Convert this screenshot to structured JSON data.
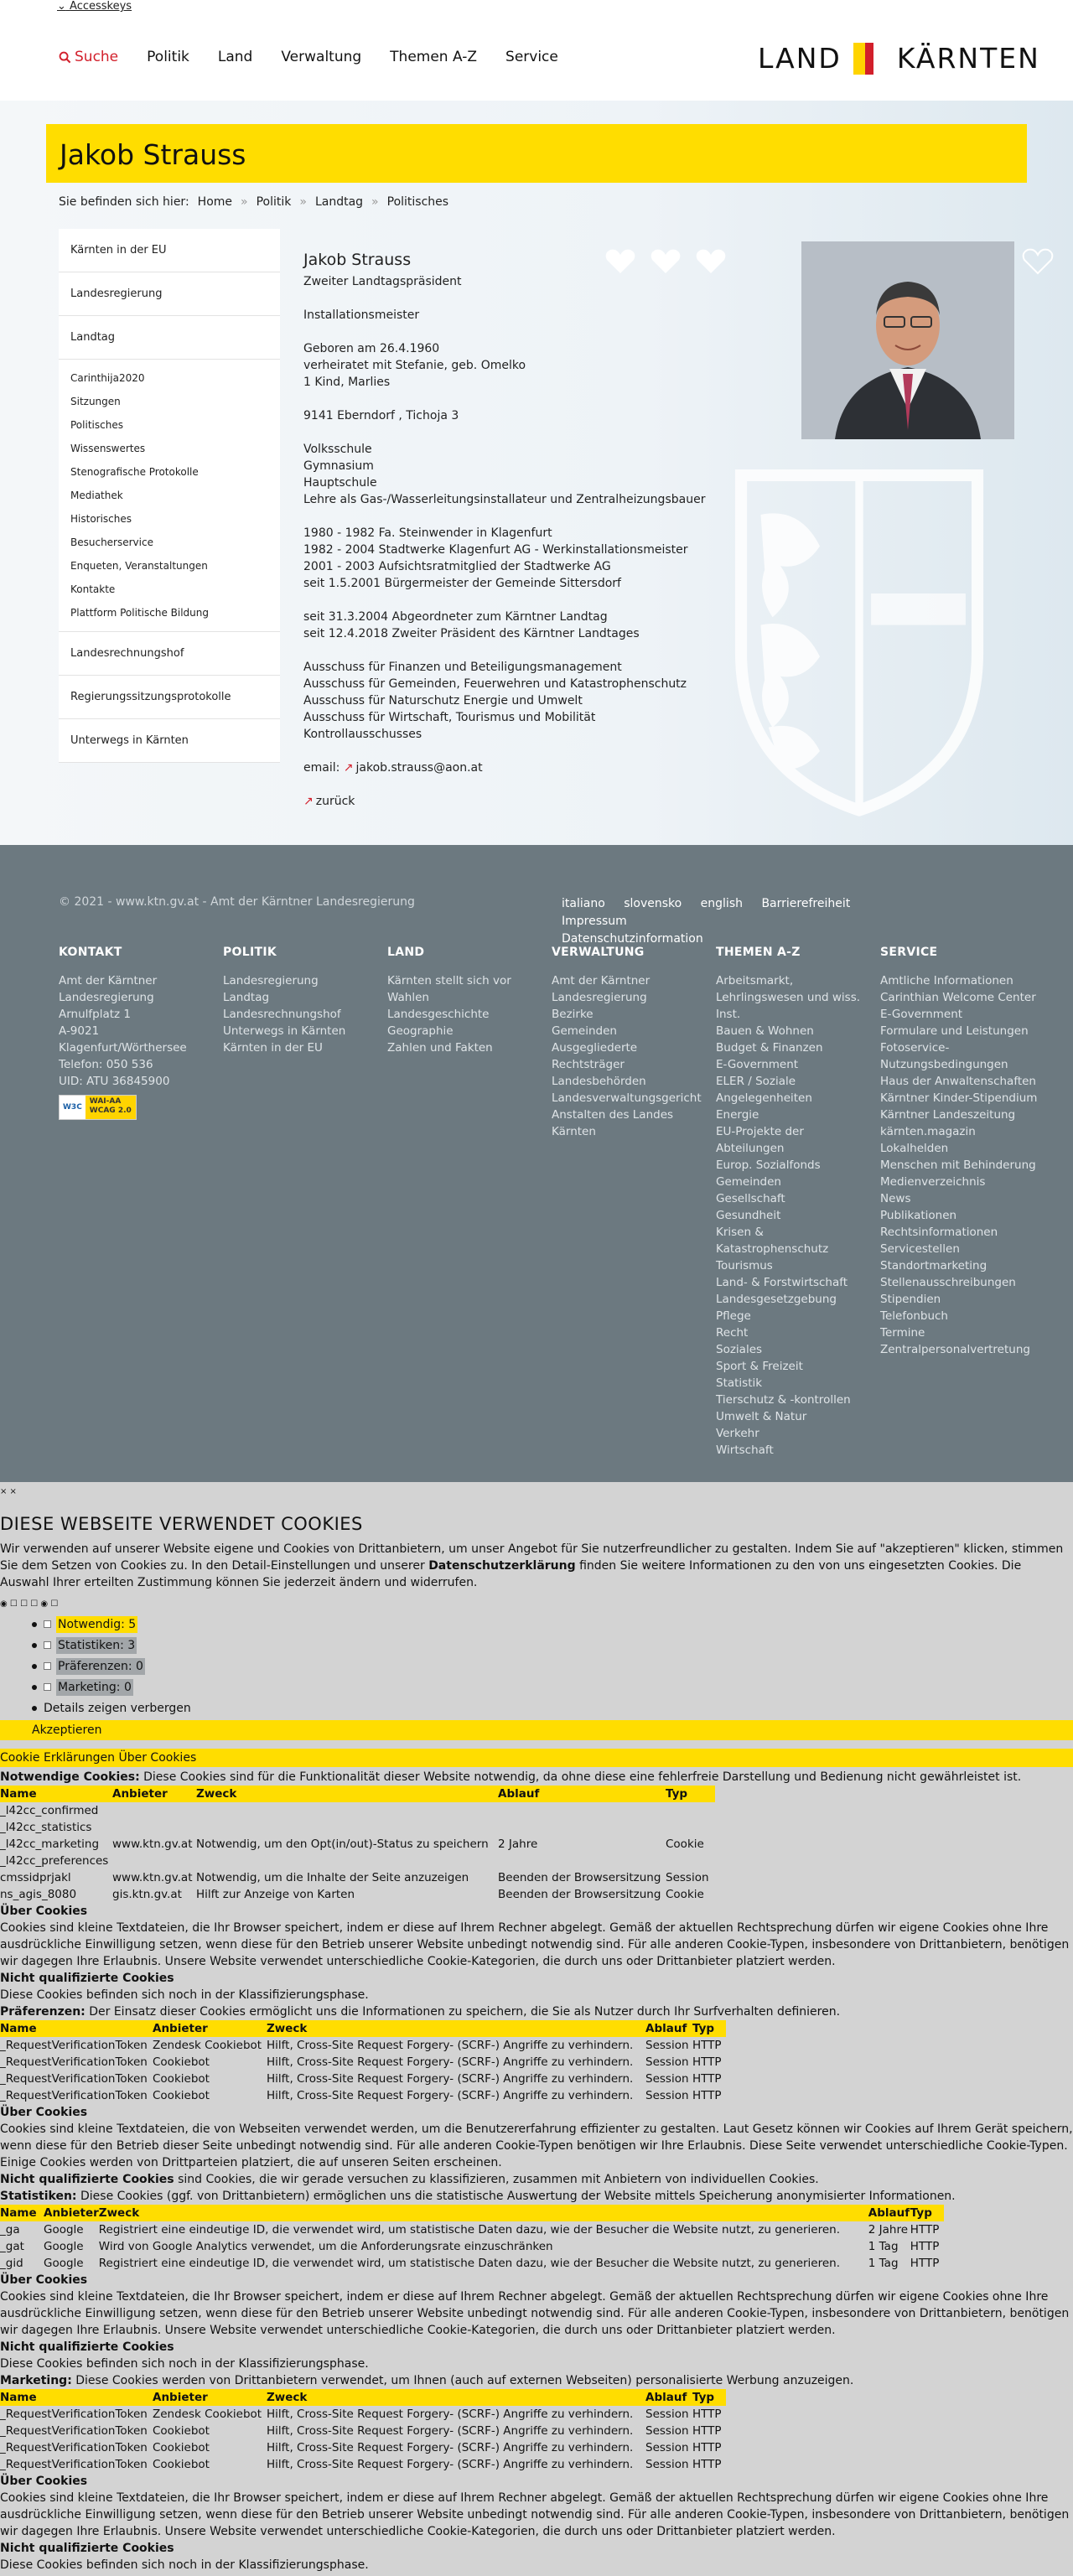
{
  "header": {
    "accesskeys": "Accesskeys",
    "nav": [
      "Suche",
      "Politik",
      "Land",
      "Verwaltung",
      "Themen A-Z",
      "Service"
    ],
    "logo_left": "LAND",
    "logo_right": "KÄRNTEN"
  },
  "page": {
    "title": "Jakob Strauss",
    "breadcrumb_prefix": "Sie befinden sich hier:",
    "breadcrumb": [
      "Home",
      "Politik",
      "Landtag",
      "Politisches"
    ]
  },
  "sidebar": {
    "top": [
      "Kärnten in der EU",
      "Landesregierung",
      "Landtag"
    ],
    "sub": [
      "Carinthija2020",
      "Sitzungen",
      "Politisches",
      "Wissenswertes",
      "Stenografische Protokolle",
      "Mediathek",
      "Historisches",
      "Besucherservice",
      "Enqueten, Veranstaltungen",
      "Kontakte",
      "Plattform Politische Bildung"
    ],
    "bottom": [
      "Landesrechnungshof",
      "Regierungssitzungsprotokolle",
      "Unterwegs in Kärnten"
    ]
  },
  "profile": {
    "name": "Jakob Strauss",
    "role": "Zweiter Landtagspräsident",
    "profession": "Installationsmeister",
    "personal": [
      "Geboren am 26.4.1960",
      "verheiratet mit Stefanie, geb. Omelko",
      "1 Kind, Marlies"
    ],
    "address": "9141 Eberndorf , Tichoja 3",
    "education": [
      "Volksschule",
      "Gymnasium",
      "Hauptschule",
      "Lehre als Gas-/Wasserleitungsinstallateur und Zentralheizungsbauer"
    ],
    "career": [
      "1980 - 1982 Fa. Steinwender in Klagenfurt",
      "1982 - 2004 Stadtwerke Klagenfurt AG - Werkinstallationsmeister",
      "2001 - 2003 Aufsichtsratmitglied der Stadtwerke AG",
      "seit 1.5.2001 Bürgermeister der Gemeinde Sittersdorf"
    ],
    "politics": [
      "seit 31.3.2004 Abgeordneter zum Kärntner Landtag",
      "seit 12.4.2018 Zweiter Präsident des Kärntner Landtages"
    ],
    "committees": [
      "Ausschuss für Finanzen und Beteiligungsmanagement",
      "Ausschuss für Gemeinden, Feuerwehren und Katastrophenschutz",
      "Ausschuss für Naturschutz Energie und Umwelt",
      "Ausschuss für Wirtschaft, Tourismus und Mobilität",
      "Kontrollausschusses"
    ],
    "email_label": "email:",
    "email": "jakob.strauss@aon.at",
    "back": "zurück"
  },
  "footer": {
    "copyright": "© 2021 - www.ktn.gv.at - Amt der Kärntner Landesregierung",
    "links": [
      "italiano",
      "slovensko",
      "english",
      "Barrierefreiheit",
      "Impressum",
      "Datenschutzinformation"
    ],
    "columns": [
      {
        "title": "KONTAKT",
        "items": [
          "Amt der Kärntner Landesregierung",
          "Arnulfplatz 1",
          "A-9021 Klagenfurt/Wörthersee",
          "Telefon: 050 536",
          "UID: ATU 36845900"
        ]
      },
      {
        "title": "POLITIK",
        "items": [
          "Landesregierung",
          "Landtag",
          "Landesrechnungshof",
          "Unterwegs in Kärnten",
          "Kärnten in der EU"
        ]
      },
      {
        "title": "LAND",
        "items": [
          "Kärnten stellt sich vor",
          "Wahlen",
          "Landesgeschichte",
          "Geographie",
          "Zahlen und Fakten"
        ]
      },
      {
        "title": "VERWALTUNG",
        "items": [
          "Amt der Kärntner Landesregierung",
          "Bezirke",
          "Gemeinden",
          "Ausgegliederte Rechtsträger",
          "Landesbehörden",
          "Landesverwaltungsgericht",
          "Anstalten des Landes Kärnten"
        ]
      },
      {
        "title": "THEMEN A-Z",
        "items": [
          "Arbeitsmarkt, Lehrlingswesen und wiss. Inst.",
          "Bauen & Wohnen",
          "Budget & Finanzen",
          "E-Government",
          "ELER / Soziale Angelegenheiten",
          "Energie",
          "EU-Projekte der Abteilungen",
          "Europ. Sozialfonds",
          "Gemeinden",
          "Gesellschaft",
          "Gesundheit",
          "Krisen & Katastrophenschutz",
          "Tourismus",
          "Land- & Forstwirtschaft",
          "Landesgesetzgebung",
          "Pflege",
          "Recht",
          "Soziales",
          "Sport & Freizeit",
          "Statistik",
          "Tierschutz & -kontrollen",
          "Umwelt & Natur",
          "Verkehr",
          "Wirtschaft"
        ]
      },
      {
        "title": "SERVICE",
        "items": [
          "Amtliche Informationen",
          "Carinthian Welcome Center",
          "E-Government",
          "Formulare und Leistungen",
          "Fotoservice-Nutzungsbedingungen",
          "Haus der Anwaltenschaften",
          "Kärntner Kinder-Stipendium",
          "Kärntner Landeszeitung",
          "kärnten.magazin",
          "Lokalhelden",
          "Menschen mit Behinderung",
          "Medienverzeichnis",
          "News",
          "Publikationen",
          "Rechtsinformationen",
          "Servicestellen",
          "Standortmarketing",
          "Stellenausschreibungen",
          "Stipendien",
          "Telefonbuch",
          "Termine",
          "Zentralpersonalvertretung"
        ]
      }
    ],
    "wcag": [
      "WAI-AA",
      "WCAG 2.0"
    ],
    "w3c": "W3C"
  },
  "cookie": {
    "close": "× ×",
    "title": "DIESE WEBSEITE VERWENDET COOKIES",
    "intro_a": "Wir verwenden auf unserer Website eigene und Cookies von Drittanbietern, um unser Angebot für Sie nutzerfreundlicher zu gestalten. Indem Sie auf \"akzeptieren\" klicken, stimmen Sie dem Setzen von Cookies zu. In den Detail-Einstellungen und unserer ",
    "intro_link": "Datenschutzerklärung",
    "intro_b": " finden Sie weitere Informationen zu den von uns eingesetzten Cookies. Die Auswahl Ihrer erteilten Zustimmung können Sie jederzeit ändern und widerrufen.",
    "categories": [
      {
        "label": "Notwendig: 5",
        "hl": "y"
      },
      {
        "label": "Statistiken: 3",
        "hl": "g"
      },
      {
        "label": "Präferenzen: 0",
        "hl": "g"
      },
      {
        "label": "Marketing: 0",
        "hl": "g"
      }
    ],
    "details": "Details zeigen verbergen",
    "accept": "Akzeptieren",
    "tabs": "Cookie Erklärungen Über Cookies",
    "necessary_label": "Notwendige Cookies:",
    "necessary_desc": " Diese Cookies sind für die Funktionalität dieser Website notwendig, da ohne diese eine fehlerfreie Darstellung und Bedienung nicht gewährleistet ist.",
    "headers_long": [
      "Name",
      "Anbieter",
      "Zweck",
      "Ablauf",
      "Typ"
    ],
    "necessary_rows": [
      [
        "_l42cc_confirmed",
        "",
        "",
        "",
        ""
      ],
      [
        "_l42cc_statistics",
        "",
        "",
        "",
        ""
      ],
      [
        "_l42cc_marketing",
        "www.ktn.gv.at",
        "Notwendig, um den Opt(in/out)-Status zu speichern",
        "2 Jahre",
        "Cookie"
      ],
      [
        "_l42cc_preferences",
        "",
        "",
        "",
        ""
      ],
      [
        "cmssidprjakl",
        "www.ktn.gv.at",
        "Notwendig, um die Inhalte der Seite anzuzeigen",
        "Beenden der Browsersitzung",
        "Session"
      ],
      [
        "ns_agis_8080",
        "gis.ktn.gv.at",
        "Hilft zur Anzeige von Karten",
        "Beenden der Browsersitzung",
        "Cookie"
      ]
    ],
    "about_title": "Über Cookies",
    "about_text": "Cookies sind kleine Textdateien, die Ihr Browser speichert, indem er diese auf Ihrem Rechner abgelegt. Gemäß der aktuellen Rechtsprechung dürfen wir eigene Cookies ohne Ihre ausdrückliche Einwilligung setzen, wenn diese für den Betrieb unserer Website unbedingt notwendig sind. Für alle anderen Cookie-Typen, insbesondere von Drittanbietern, benötigen wir dagegen Ihre Erlaubnis. Unsere Website verwendet unterschiedliche Cookie-Kategorien, die durch uns oder Drittanbieter platziert werden.",
    "unclassified_title": "Nicht qualifizierte Cookies",
    "unclassified_text": "Diese Cookies befinden sich noch in der Klassifizierungsphase.",
    "pref_label": "Präferenzen:",
    "pref_desc": " Der Einsatz dieser Cookies ermöglicht uns die Informationen zu speichern, die Sie als Nutzer durch Ihr Surfverhalten definieren.",
    "rvt_rows": [
      [
        "_RequestVerificationToken",
        "Zendesk Cookiebot",
        "Hilft, Cross-Site Request Forgery- (SCRF-) Angriffe zu verhindern.",
        "Session",
        "HTTP"
      ],
      [
        "_RequestVerificationToken",
        "Cookiebot",
        "Hilft, Cross-Site Request Forgery- (SCRF-) Angriffe zu verhindern.",
        "Session",
        "HTTP"
      ],
      [
        "_RequestVerificationToken",
        "Cookiebot",
        "Hilft, Cross-Site Request Forgery- (SCRF-) Angriffe zu verhindern.",
        "Session",
        "HTTP"
      ],
      [
        "_RequestVerificationToken",
        "Cookiebot",
        "Hilft, Cross-Site Request Forgery- (SCRF-) Angriffe zu verhindern.",
        "Session",
        "HTTP"
      ]
    ],
    "about_text_2": "Cookies sind kleine Textdateien, die von Webseiten verwendet werden, um die Benutzererfahrung effizienter zu gestalten. Laut Gesetz können wir Cookies auf Ihrem Gerät speichern, wenn diese für den Betrieb dieser Seite unbedingt notwendig sind. Für alle anderen Cookie-Typen benötigen wir Ihre Erlaubnis. Diese Seite verwendet unterschiedliche Cookie-Typen. Einige Cookies werden von Drittparteien platziert, die auf unseren Seiten erscheinen.",
    "unclassified_text_2_label": "Nicht qualifizierte Cookies",
    "unclassified_text_2": " sind Cookies, die wir gerade versuchen zu klassifizieren, zusammen mit Anbietern von individuellen Cookies.",
    "stat_label": "Statistiken:",
    "stat_desc": " Diese Cookies (ggf. von Drittanbietern) ermöglichen uns die statistische Auswertung der Website mittels Speicherung anonymisierter Informationen.",
    "stat_rows": [
      [
        "_ga",
        "Google",
        "Registriert eine eindeutige ID, die verwendet wird, um statistische Daten dazu, wie der Besucher die Website nutzt, zu generieren.",
        "2 Jahre",
        "HTTP"
      ],
      [
        "_gat",
        "Google",
        "Wird von Google Analytics verwendet, um die Anforderungsrate einzuschränken",
        "1 Tag",
        "HTTP"
      ],
      [
        "_gid",
        "Google",
        "Registriert eine eindeutige ID, die verwendet wird, um statistische Daten dazu, wie der Besucher die Website nutzt, zu generieren.",
        "1 Tag",
        "HTTP"
      ]
    ],
    "mkt_label": "Marketing:",
    "mkt_desc": " Diese Cookies werden von Drittanbietern verwendet, um Ihnen (auch auf externen Webseiten) personalisierte Werbung anzuzeigen.",
    "headers_short": [
      "Name",
      "Anbieter",
      "Zweck",
      "Ablauf",
      "Typ"
    ]
  },
  "colors": {
    "yellow": "#ffdd00",
    "red": "#d21f2b",
    "footer": "#6c7980",
    "cookie_bg": "#d3d3d3"
  }
}
